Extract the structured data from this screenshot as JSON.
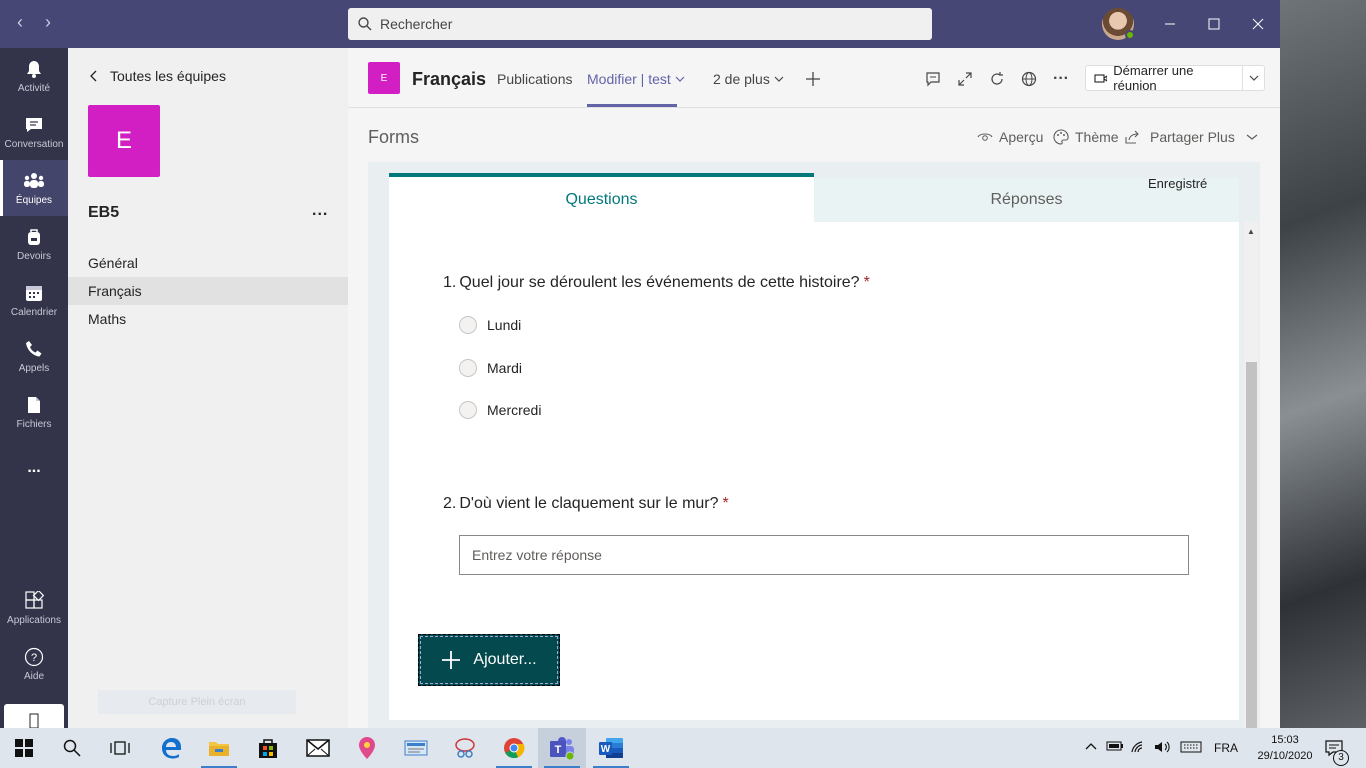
{
  "titlebar": {
    "search_placeholder": "Rechercher"
  },
  "rail": {
    "items": [
      {
        "label": "Activité",
        "icon": "bell-icon"
      },
      {
        "label": "Conversation",
        "icon": "chat-icon"
      },
      {
        "label": "Équipes",
        "icon": "teams-icon"
      },
      {
        "label": "Devoirs",
        "icon": "backpack-icon"
      },
      {
        "label": "Calendrier",
        "icon": "calendar-icon"
      },
      {
        "label": "Appels",
        "icon": "phone-icon"
      },
      {
        "label": "Fichiers",
        "icon": "file-icon"
      }
    ],
    "more": "...",
    "apps_label": "Applications",
    "help_label": "Aide"
  },
  "teampanel": {
    "back_label": "Toutes les équipes",
    "team_initial": "E",
    "team_name": "EB5",
    "more": "...",
    "channels": [
      "Général",
      "Français",
      "Maths"
    ],
    "capture_label": "Capture Plein écran"
  },
  "channel_header": {
    "initial": "E",
    "name": "Français",
    "tabs": [
      "Publications",
      "Modifier | test",
      "2 de plus"
    ],
    "meet_label": "Démarrer une réunion"
  },
  "forms": {
    "title": "Forms",
    "preview_label": "Aperçu",
    "theme_label": "Thème",
    "share_label": "Partager Plus",
    "tab_questions": "Questions",
    "tab_responses": "Réponses",
    "saved_label": "Enregistré",
    "questions": [
      {
        "number": "1.",
        "text": "Quel jour se déroulent les événements de cette histoire?",
        "required": "*",
        "options": [
          "Lundi",
          "Mardi",
          "Mercredi"
        ]
      },
      {
        "number": "2.",
        "text": "D'où vient le claquement sur le mur?",
        "required": "*",
        "placeholder": "Entrez votre réponse"
      }
    ],
    "add_label": "Ajouter..."
  },
  "taskbar": {
    "lang": "FRA",
    "time": "15:03",
    "date": "29/10/2020",
    "notifications": "3"
  },
  "colors": {
    "teams_purple": "#464775",
    "rail": "#33344a",
    "accent": "#6264a7",
    "team_tile": "#d11fc4",
    "forms_teal": "#03787c",
    "add_button": "#03494d"
  }
}
